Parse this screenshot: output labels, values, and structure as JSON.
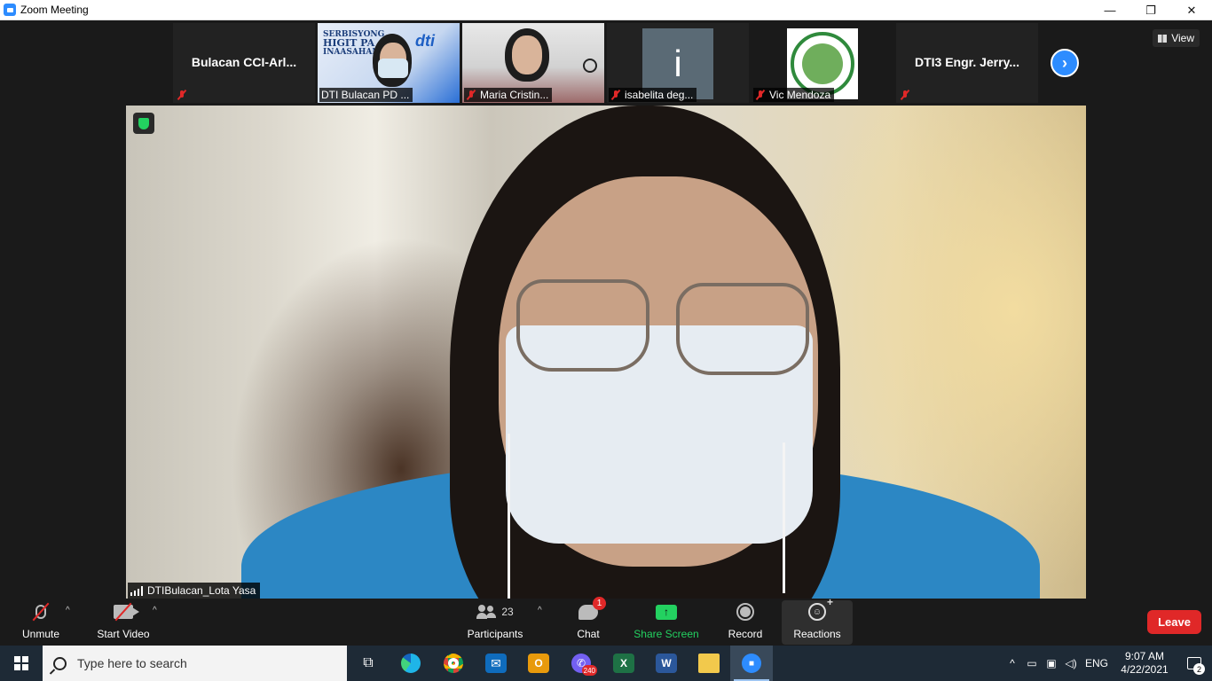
{
  "window": {
    "title": "Zoom Meeting",
    "minimize_glyph": "—",
    "restore_glyph": "❐",
    "close_glyph": "✕"
  },
  "gallery": {
    "tiles": [
      {
        "name": "Bulacan  CCI-Arl...",
        "muted": true,
        "video": false
      },
      {
        "name": "DTI Bulacan PD ...",
        "muted": true,
        "video": true
      },
      {
        "name": "Maria Cristin...",
        "muted": true,
        "video": true
      },
      {
        "name": "isabelita deg...",
        "muted": true,
        "video": false,
        "avatar_letter": "i"
      },
      {
        "name": "Vic Mendoza",
        "muted": true,
        "video": false
      },
      {
        "name": "DTI3  Engr. Jerry...",
        "muted": true,
        "video": false
      }
    ],
    "dti_banner": {
      "line1": "SERBISYONG",
      "line2": "HIGIT PA",
      "line3": "INAASAHAN",
      "logo": "dti"
    },
    "next_glyph": "›",
    "view_label": "View"
  },
  "main_video": {
    "speaker_name": "DTIBulacan_Lota Yasa",
    "encrypted_icon": "shield-check-icon"
  },
  "toolbar": {
    "unmute_label": "Unmute",
    "start_video_label": "Start Video",
    "participants_label": "Participants",
    "participants_count": "23",
    "chat_label": "Chat",
    "chat_badge": "1",
    "share_label": "Share Screen",
    "share_glyph": "↑",
    "record_label": "Record",
    "reactions_label": "Reactions",
    "reactions_glyph": "☺",
    "reactions_plus": "+",
    "leave_label": "Leave",
    "caret_glyph": "^",
    "colors": {
      "leave": "#e02828",
      "share": "#23d160",
      "accent": "#2d8cff"
    }
  },
  "taskbar": {
    "search_placeholder": "Type here to search",
    "apps": [
      {
        "name": "task-view",
        "glyph": "⧉"
      },
      {
        "name": "edge",
        "glyph": ""
      },
      {
        "name": "chrome",
        "glyph": ""
      },
      {
        "name": "mail",
        "glyph": "✉"
      },
      {
        "name": "outlook",
        "glyph": "O"
      },
      {
        "name": "viber",
        "glyph": "✆",
        "badge": "240"
      },
      {
        "name": "excel",
        "glyph": "X"
      },
      {
        "name": "word",
        "glyph": "W"
      },
      {
        "name": "file-explorer",
        "glyph": ""
      },
      {
        "name": "zoom",
        "glyph": "■"
      }
    ],
    "tray": {
      "chevron": "^",
      "language": "ENG",
      "time": "9:07 AM",
      "date": "4/22/2021",
      "notification_count": "2"
    }
  }
}
